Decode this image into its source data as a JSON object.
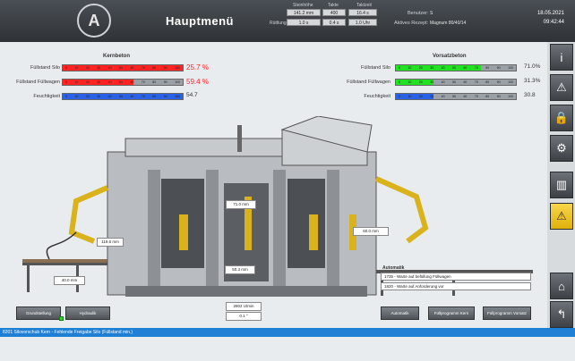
{
  "header": {
    "logo_letter": "A",
    "title": "Hauptmenü",
    "col_labels": [
      "Steinhöhe",
      "Takte",
      "Taktzeit"
    ],
    "row1_values": [
      "141.2 mm",
      "400",
      "16.4 s"
    ],
    "row2_label": "Rüttlung",
    "row2_values": [
      "1.0 s",
      "0.4 s",
      "1.0 Uhr"
    ],
    "user_label": "Benutzer:",
    "user_value": "S",
    "recipe_label": "Aktives Rezept:",
    "recipe_value": "Magnum 80/40/14",
    "date": "18.05.2021",
    "time": "09:42:44"
  },
  "kernbeton": {
    "title": "Kernbeton",
    "rows": [
      {
        "label": "Füllstand Silo",
        "fraction": 1.0,
        "color": "#ff2424",
        "value": "25.7 %",
        "value_color": "#ff2424"
      },
      {
        "label": "Füllstand Füllwagen",
        "fraction": 0.59,
        "color": "#ff2424",
        "value": "59.4 %",
        "value_color": "#ff2424"
      },
      {
        "label": "Feuchtigkeit",
        "fraction": 1.0,
        "color": "#2a62e6",
        "value": "54.7",
        "value_color": "#333333"
      }
    ]
  },
  "vorsatzbeton": {
    "title": "Vorsatzbeton",
    "rows": [
      {
        "label": "Füllstand Silo",
        "fraction": 0.71,
        "color": "#22e022",
        "value": "71.0%",
        "value_color": "#333333"
      },
      {
        "label": "Füllstand Füllwagen",
        "fraction": 0.31,
        "color": "#22e022",
        "value": "31.3%",
        "value_color": "#333333"
      },
      {
        "label": "Feuchtigkeit",
        "fraction": 0.31,
        "color": "#2a62e6",
        "value": "30.8",
        "value_color": "#333333"
      }
    ]
  },
  "bar_ticks": [
    "0",
    "10",
    "20",
    "30",
    "40",
    "50",
    "60",
    "70",
    "80",
    "90",
    "100"
  ],
  "machine_values": {
    "v1": "71.0 mm",
    "v2": "60.0 mm",
    "v3": "119.6 mm",
    "v4": "50.3 mm",
    "v5": "40.0 mm",
    "rpm": "2802 U/min",
    "angle": "0.1 °"
  },
  "automatik": {
    "title": "Automatik",
    "messages": [
      "1735 - Warte auf befüllung Füllwagen",
      "1820 - Warte auf Anforderung vor"
    ]
  },
  "buttons": {
    "grundstellung": "Grundstellung",
    "hydraulik": "Hydraulik",
    "automatik": "Automatik",
    "fuellprog_kern": "Füllprogramm Kern",
    "fuellprog_vorsatz": "Füllprogramm Vorsatz"
  },
  "status_text": "8201 Silovorschub Kern - Fehlende Freigabe Silo (Füllstand min.)",
  "sidebar_icons": [
    "info-icon",
    "warning-icon",
    "lock-icon",
    "settings-icon",
    "machine-icon",
    "hazard-icon",
    "home-icon",
    "back-icon"
  ]
}
